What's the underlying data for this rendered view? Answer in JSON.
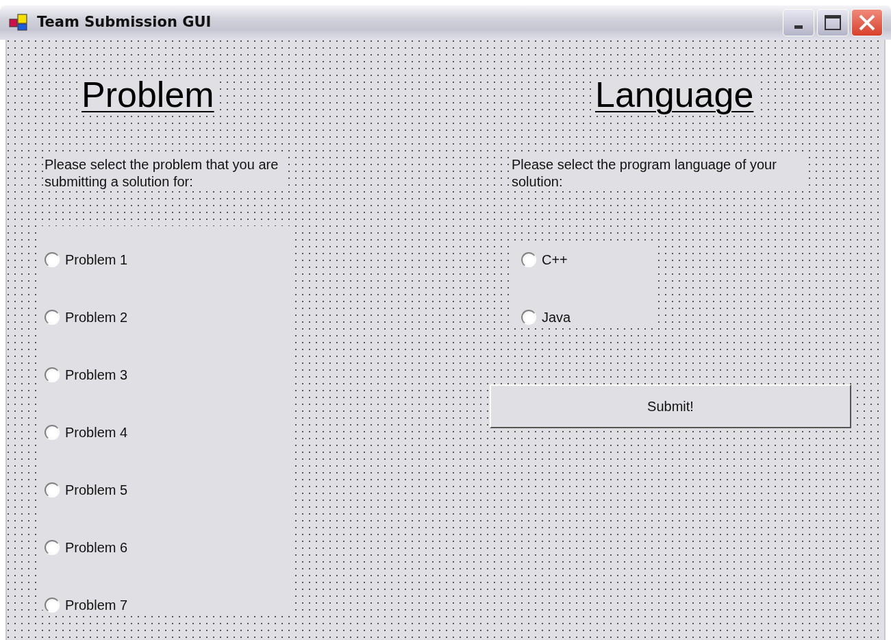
{
  "window": {
    "title": "Team Submission GUI"
  },
  "problem": {
    "heading": "Problem",
    "prompt": "Please select the problem that you are submitting a solution for:",
    "options": [
      {
        "label": "Problem 1",
        "selected": false
      },
      {
        "label": "Problem 2",
        "selected": false
      },
      {
        "label": "Problem 3",
        "selected": false
      },
      {
        "label": "Problem 4",
        "selected": false
      },
      {
        "label": "Problem 5",
        "selected": false
      },
      {
        "label": "Problem 6",
        "selected": false
      },
      {
        "label": "Problem 7",
        "selected": false
      }
    ]
  },
  "language": {
    "heading": "Language",
    "prompt": "Please select the program language of your solution:",
    "options": [
      {
        "label": "C++",
        "selected": false
      },
      {
        "label": "Java",
        "selected": false
      }
    ]
  },
  "submit_button": "Submit!"
}
